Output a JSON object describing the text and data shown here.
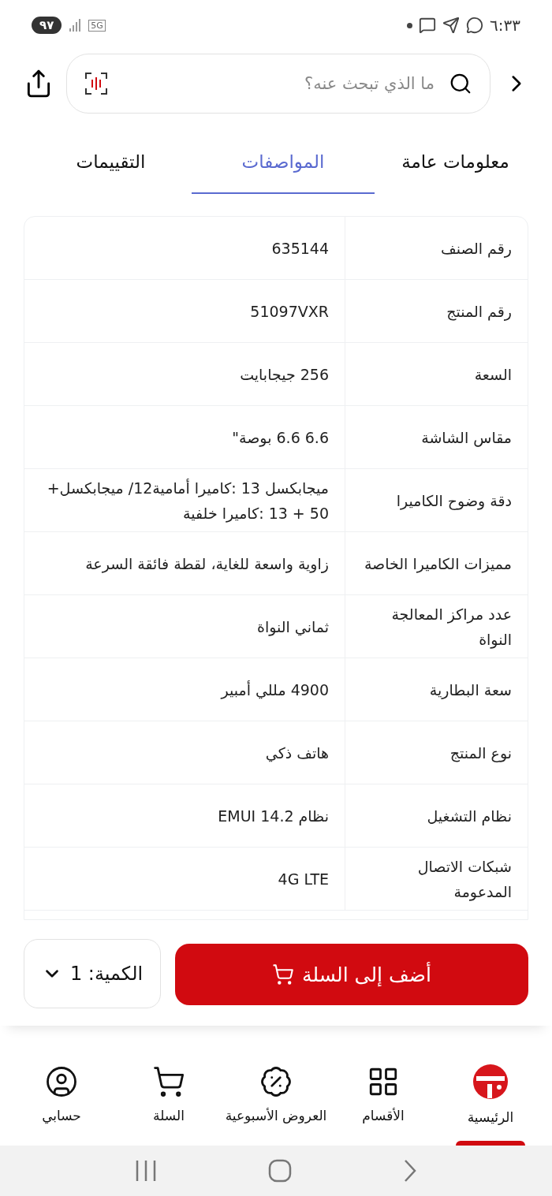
{
  "status_bar": {
    "time": "٦:٣٣",
    "network": "5G",
    "battery": "٩٧"
  },
  "search": {
    "placeholder": "ما الذي تبحث عنه؟"
  },
  "tabs": [
    {
      "label": "معلومات عامة",
      "selected": false
    },
    {
      "label": "المواصفات",
      "selected": true
    },
    {
      "label": "التقييمات",
      "selected": false
    }
  ],
  "specs": [
    {
      "name": "رقم الصنف",
      "value": "635144"
    },
    {
      "name": "رقم المنتج",
      "value": "51097VXR"
    },
    {
      "name": "السعة",
      "value": "256 جيجابايت"
    },
    {
      "name": "مقاس الشاشة",
      "value": "6.6 6.6 بوصة\""
    },
    {
      "name": "دقة وضوح الكاميرا",
      "value": "ميجابكسل 13 :كاميرا أمامية12/ ميجابكسل+ 50 + 13 :كاميرا خلفية"
    },
    {
      "name": "مميزات الكاميرا الخاصة",
      "value": "زاوية واسعة للغاية، لقطة فائقة السرعة"
    },
    {
      "name": "عدد مراكز المعالجة النواة",
      "value": "ثماني النواة"
    },
    {
      "name": "سعة البطارية",
      "value": "4900 مللي أمبير"
    },
    {
      "name": "نوع المنتج",
      "value": "هاتف ذكي"
    },
    {
      "name": "نظام التشغيل",
      "value": "نظام EMUI 14.2"
    },
    {
      "name": "شبكات الاتصال المدعومة",
      "value": "4G LTE"
    }
  ],
  "add_to_cart": {
    "label": "أضف إلى السلة"
  },
  "quantity": {
    "label": "الكمية: 1"
  },
  "bottom_nav": [
    {
      "kind": "home",
      "label": "الرئيسية",
      "selected": true
    },
    {
      "kind": "categories",
      "label": "الأقسام",
      "selected": false
    },
    {
      "kind": "offers",
      "label": "العروض الأسبوعية",
      "selected": false
    },
    {
      "kind": "cart",
      "label": "السلة",
      "selected": false
    },
    {
      "kind": "account",
      "label": "حسابي",
      "selected": false
    }
  ]
}
